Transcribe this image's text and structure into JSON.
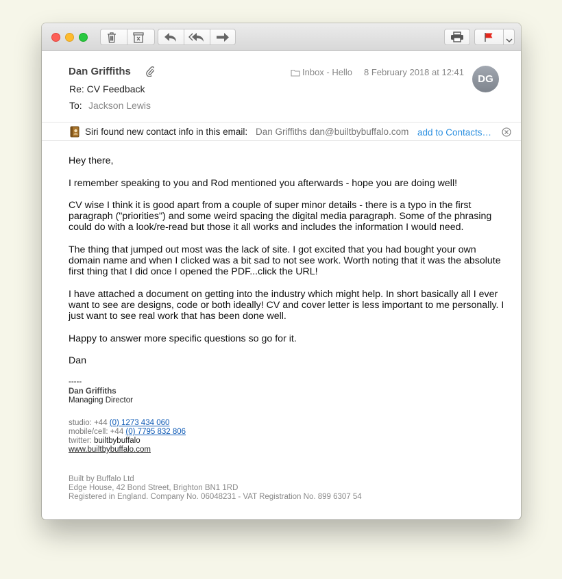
{
  "toolbar": {
    "buttons": [
      "trash-icon",
      "junk-icon",
      "reply-icon",
      "reply-all-icon",
      "forward-icon",
      "print-icon",
      "flag-icon",
      "chevron-down-icon"
    ],
    "flag_color": "#e4281d"
  },
  "header": {
    "from": "Dan Griffiths",
    "subject": "Re: CV Feedback",
    "to_label": "To:",
    "to": "Jackson Lewis",
    "mailbox": "Inbox - Hello",
    "date": "8 February 2018 at 12:41",
    "avatar_initials": "DG"
  },
  "siri": {
    "text": "Siri found new contact info in this email:",
    "contact": "Dan Griffiths dan@builtbybuffalo.com",
    "action": "add to Contacts…"
  },
  "message": {
    "greeting": "Hey there,",
    "paragraphs": [
      "I remember speaking to you and Rod mentioned you afterwards - hope you are doing well!",
      "CV wise I think it is good apart from a couple of super minor details - there is a typo in the first paragraph (\"priorities\") and some weird spacing the digital media paragraph. Some of the phrasing could do with a look/re-read but those it all works and includes the information I would need.",
      "The thing that jumped out most was the lack of site. I got excited that you had bought your own domain name and when I clicked was a bit sad to not see work.  Worth noting that it was the absolute first thing that I did once I opened the PDF...click the URL!",
      "I have attached a document on getting into the industry which might help. In short basically all I ever want to see are designs, code or both ideally!  CV and cover letter is less important to me personally. I just want to see real work that has been done well.",
      "Happy to answer more specific questions so go for it."
    ],
    "signoff": "Dan"
  },
  "signature": {
    "dashes": "-----",
    "name": "Dan Griffiths",
    "title": "Managing Director",
    "studio_label": "studio: +44 ",
    "studio_number": "(0) 1273 434 060",
    "mobile_label": "mobile/cell: +44 ",
    "mobile_number": "(0) 7795 832 806",
    "twitter_label": "twitter: ",
    "twitter_handle": "builtbybuffalo",
    "website": "www.builtbybuffalo.com",
    "company": "Built by Buffalo Ltd",
    "address": "Edge House, 42 Bond Street, Brighton BN1 1RD",
    "registration": "Registered in England. Company No. 06048231 - VAT Registration No. 899 6307 54"
  }
}
